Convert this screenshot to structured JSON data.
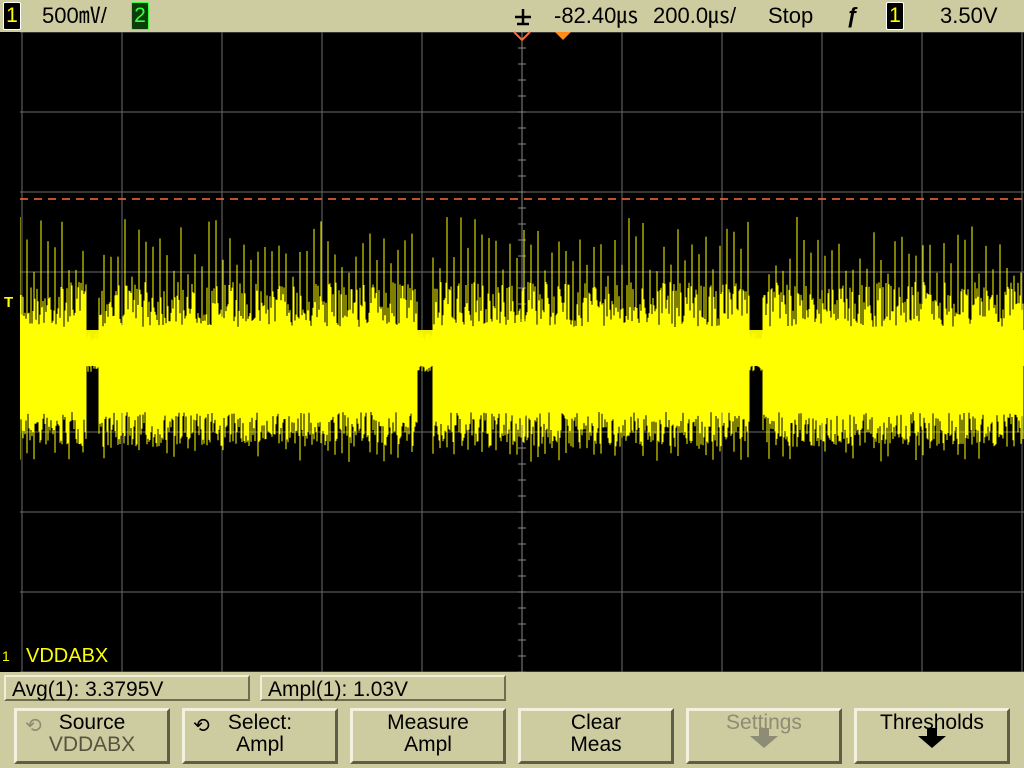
{
  "topbar": {
    "ch1_number": "1",
    "ch1_scale": "500㎷/",
    "ch2_number": "2",
    "time_delay": "-82.40㎲",
    "time_scale": "200.0㎲/",
    "run_state": "Stop",
    "trigger_slope_glyph": "ƒ",
    "trigger_source": "1",
    "trigger_level": "3.50V"
  },
  "screen": {
    "channel_label": "VDDABX",
    "ground_marker": "1",
    "trigger_marker": "T",
    "trace_color": "#ffff00",
    "trigger_line_color": "#ff6a3a",
    "grid_color": "#6b6b6b"
  },
  "measurements": {
    "avg": "Avg(1): 3.3795V",
    "ampl": "Ampl(1): 1.03V"
  },
  "softkeys": {
    "source": {
      "line1": "Source",
      "line2": "VDDABX"
    },
    "select": {
      "line1": "Select:",
      "line2": "Ampl"
    },
    "measure": {
      "line1": "Measure",
      "line2": "Ampl"
    },
    "clear": {
      "line1": "Clear",
      "line2": "Meas"
    },
    "settings": {
      "line1": "Settings",
      "enabled": false
    },
    "thresholds": {
      "line1": "Thresholds"
    }
  },
  "icons": {
    "trigger_point": "trigger-point-icon",
    "delay_marker": "delay-marker-icon",
    "rotate_knob": "knob-rotate-icon",
    "submenu": "arrow-down-icon"
  }
}
